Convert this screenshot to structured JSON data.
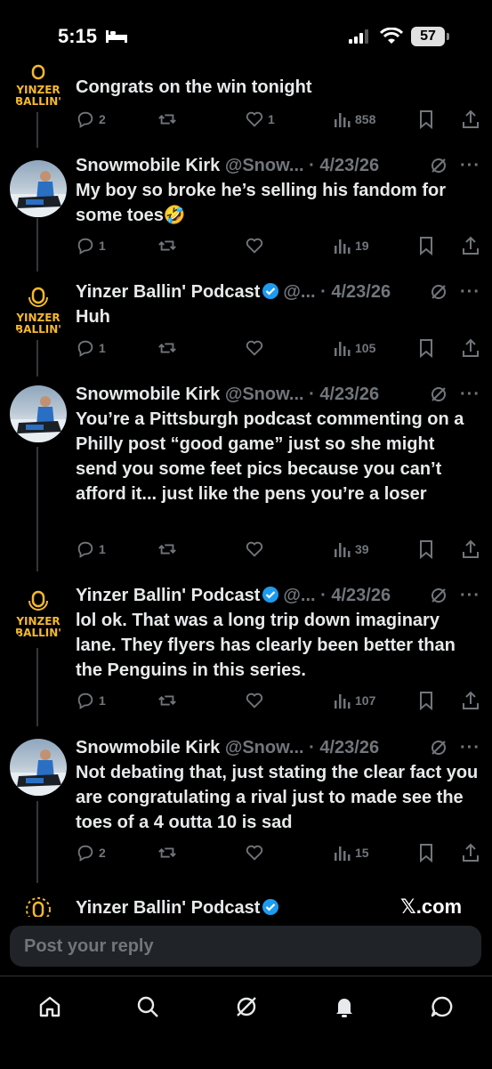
{
  "status_bar": {
    "time": "5:15",
    "battery": "57"
  },
  "tweets": [
    {
      "name": "",
      "handle": "",
      "date": "",
      "text": "Congrats on the win tonight",
      "replies": "2",
      "reposts": "",
      "likes": "1",
      "views": "858"
    },
    {
      "name": "Snowmobile Kirk",
      "handle": "@Snow...",
      "date": "· 4/23/26",
      "text": "My boy so broke he’s selling his fandom for some toes🤣",
      "replies": "1",
      "reposts": "",
      "likes": "",
      "views": "19"
    },
    {
      "name": "Yinzer Ballin' Podcast",
      "handle": "@...",
      "date": "· 4/23/26",
      "text": "Huh",
      "replies": "1",
      "reposts": "",
      "likes": "",
      "views": "105"
    },
    {
      "name": "Snowmobile Kirk",
      "handle": "@Snow...",
      "date": "· 4/23/26",
      "text": "You’re a Pittsburgh podcast commenting on a Philly post “good game” just so she might send you some feet pics because you can’t afford it... just like the pens you’re a loser",
      "replies": "1",
      "reposts": "",
      "likes": "",
      "views": "39"
    },
    {
      "name": "Yinzer Ballin' Podcast",
      "handle": "@...",
      "date": "· 4/23/26",
      "text": "lol ok. That was a long trip down imaginary lane. They flyers has clearly been better than the Penguins in this series.",
      "replies": "1",
      "reposts": "",
      "likes": "",
      "views": "107"
    },
    {
      "name": "Snowmobile Kirk",
      "handle": "@Snow...",
      "date": "· 4/23/26",
      "text": "Not debating that, just stating the clear fact you are congratulating a rival just to made see the toes of a 4 outta 10 is sad",
      "replies": "2",
      "reposts": "",
      "likes": "",
      "views": "15"
    },
    {
      "name": "Yinzer Ballin' Podcast",
      "handle": "",
      "date": "",
      "text": ""
    }
  ],
  "yinzer_logo": {
    "line1": "YINZER",
    "line2": "BALLIN'"
  },
  "watermark": "𝕏.com",
  "reply_placeholder": "Post your reply",
  "colors": {
    "accent_blue": "#1d9bf0",
    "logo_yellow": "#f5b82e",
    "muted": "#71767b"
  },
  "tab_icons": [
    "home-icon",
    "search-icon",
    "grok-icon",
    "notifications-icon",
    "messages-icon"
  ]
}
